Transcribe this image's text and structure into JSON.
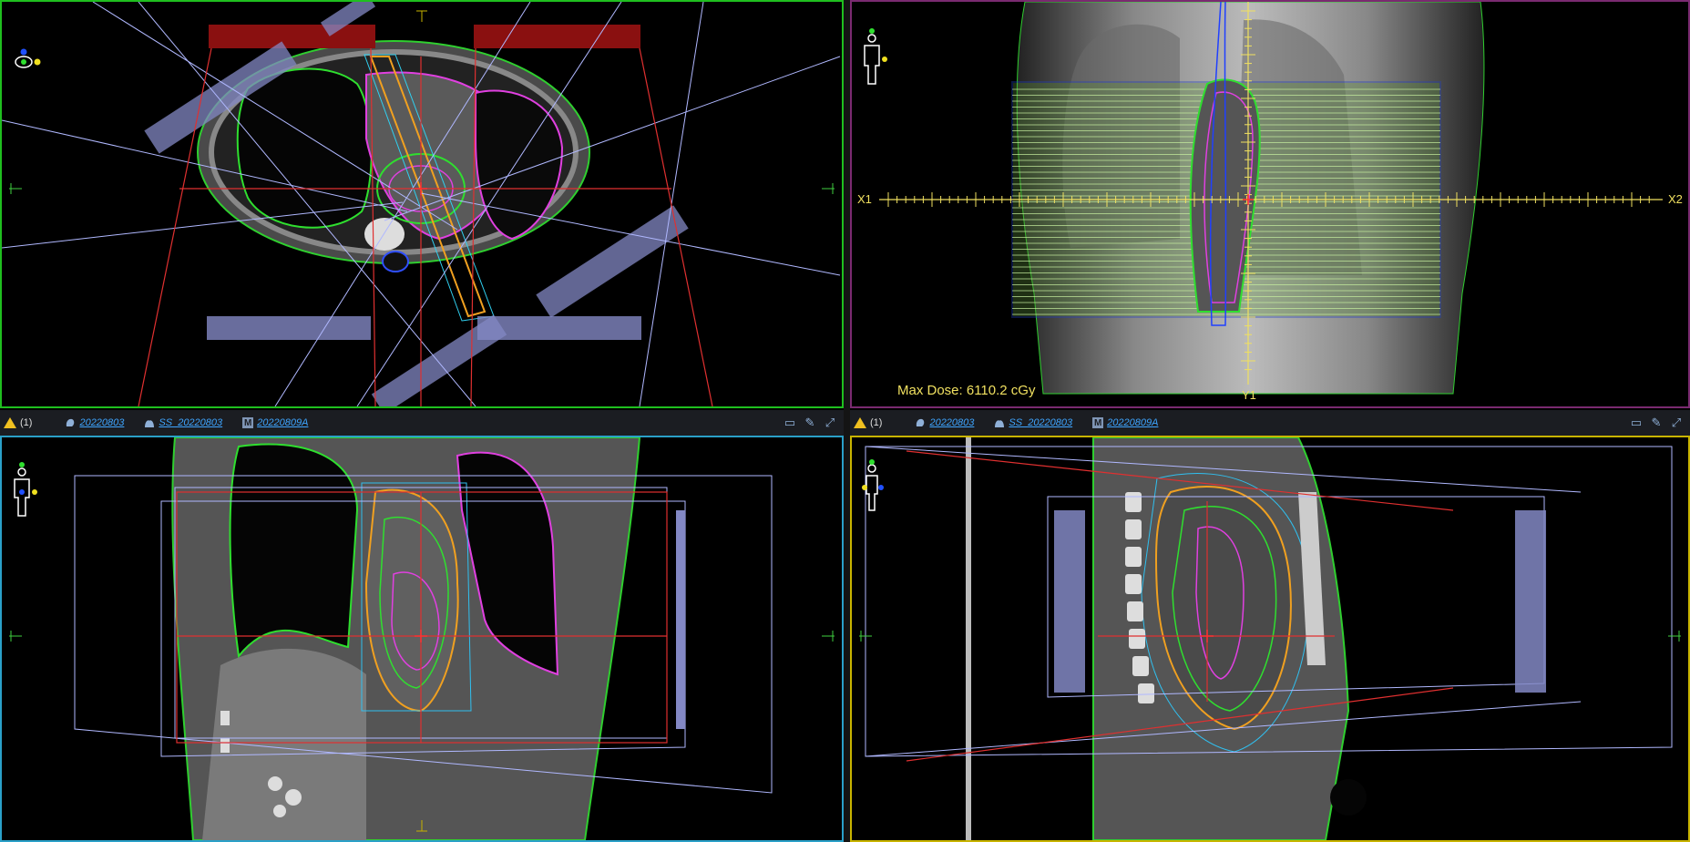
{
  "axial": {
    "name": "axial view"
  },
  "drr": {
    "max_dose_label": "Max Dose: 6110.2 cGy",
    "x1_label": "X1",
    "x2_label": "X2",
    "y1_label": "Y1"
  },
  "coronal": {
    "name": "coronal view"
  },
  "sagittal": {
    "name": "sagittal view"
  },
  "toolbar_left": {
    "warning_count": "(1)",
    "image_link": "20220803",
    "structure_set_link": "SS_20220803",
    "plan_link": "20220809A",
    "plan_badge": "M"
  },
  "toolbar_right": {
    "warning_count": "(1)",
    "image_link": "20220803",
    "structure_set_link": "SS_20220803",
    "plan_link": "20220809A",
    "plan_badge": "M"
  },
  "colors": {
    "axial_border": "#1fbf1f",
    "drr_border": "#7a2a70",
    "coronal_border": "#2aa0c8",
    "sagittal_border": "#c8b400",
    "link": "#3ea5ff",
    "dose_label": "#f0e060"
  }
}
